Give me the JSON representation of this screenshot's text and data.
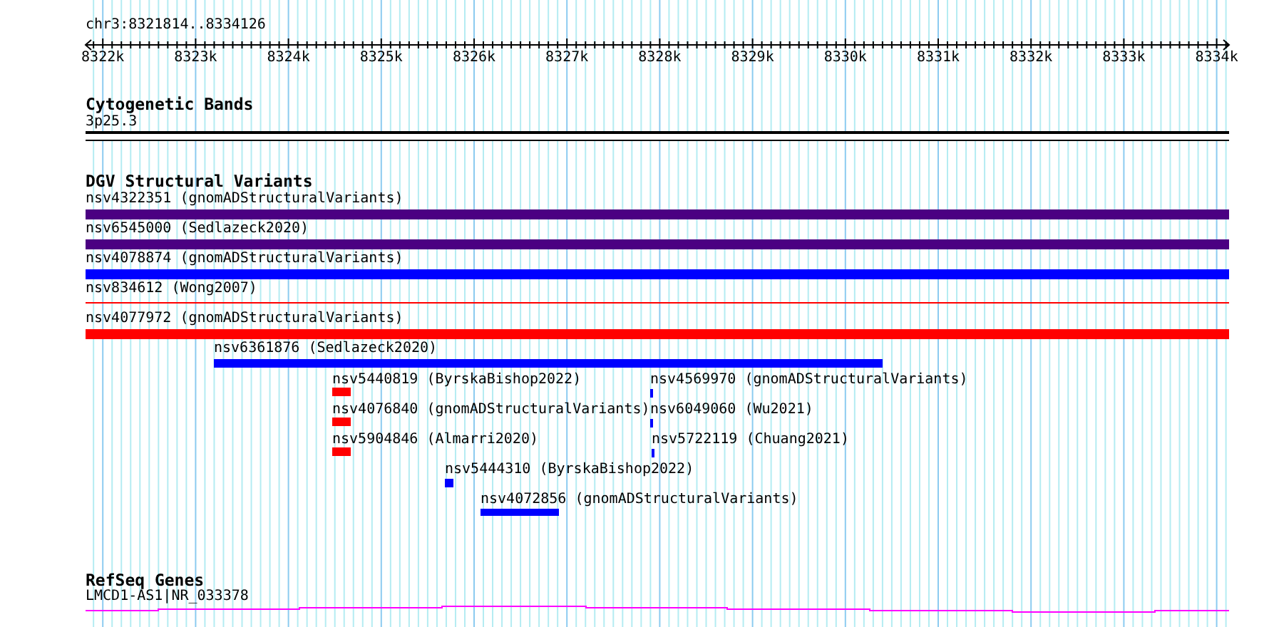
{
  "ruler": {
    "location": "chr3:8321814..8334126",
    "labels": [
      "8322k",
      "8323k",
      "8324k",
      "8325k",
      "8326k",
      "8327k",
      "8328k",
      "8329k",
      "8330k",
      "8331k",
      "8332k",
      "8333k",
      "8334k"
    ]
  },
  "cytogenetic_bands": {
    "title": "Cytogenetic Bands",
    "features": [
      {
        "label": "3p25.3"
      }
    ]
  },
  "dgv_structural_variants": {
    "title": "DGV Structural Variants",
    "features": [
      {
        "name": "nsv4322351 (gnomADStructuralVariants)",
        "color": "#4b0082",
        "kind": "bar"
      },
      {
        "name": "nsv6545000 (Sedlazeck2020)",
        "color": "#4b0082",
        "kind": "bar"
      },
      {
        "name": "nsv4078874 (gnomADStructuralVariants)",
        "color": "#0000ff",
        "kind": "bar"
      },
      {
        "name": "nsv834612 (Wong2007)",
        "color": "#ff0000",
        "kind": "line"
      },
      {
        "name": "nsv4077972 (gnomADStructuralVariants)",
        "color": "#ff0000",
        "kind": "bar"
      },
      {
        "name": "nsv6361876 (Sedlazeck2020)",
        "color": "#0000ff",
        "kind": "bar"
      },
      {
        "name": "nsv5440819 (ByrskaBishop2022)",
        "color": "#ff0000",
        "kind": "bar"
      },
      {
        "name": "nsv4569970 (gnomADStructuralVariants)",
        "color": "#0000ff",
        "kind": "bar"
      },
      {
        "name": "nsv4076840 (gnomADStructuralVariants)",
        "color": "#ff0000",
        "kind": "bar"
      },
      {
        "name": "nsv6049060 (Wu2021)",
        "color": "#0000ff",
        "kind": "bar"
      },
      {
        "name": "nsv5904846 (Almarri2020)",
        "color": "#ff0000",
        "kind": "bar"
      },
      {
        "name": "nsv5722119 (Chuang2021)",
        "color": "#0000ff",
        "kind": "bar"
      },
      {
        "name": "nsv5444310 (ByrskaBishop2022)",
        "color": "#0000ff",
        "kind": "bar"
      },
      {
        "name": "nsv4072856 (gnomADStructuralVariants)",
        "color": "#0000ff",
        "kind": "bar"
      }
    ]
  },
  "refseq_genes": {
    "title": "RefSeq Genes",
    "features": [
      {
        "label": "LMCD1-AS1|NR_033378",
        "color": "#ff00ff"
      }
    ]
  }
}
